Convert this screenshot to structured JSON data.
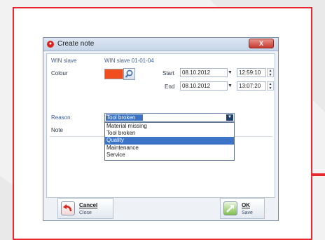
{
  "dialog": {
    "title": "Create note",
    "close_label": "X",
    "win_slave_label": "WIN slave",
    "win_slave_value": "WIN slave 01-01-04",
    "colour_label": "Colour",
    "colour_value": "#f04e1e",
    "start_label": "Start",
    "start_date": "08.10.2012",
    "start_time": "12:59:10",
    "end_label": "End",
    "end_date": "08.10.2012",
    "end_time": "13:07:20",
    "reason_label": "Reason:",
    "reason_value": "Tool broken",
    "note_label": "Note",
    "reason_options": [
      "Material missing",
      "Tool broken",
      "Quality",
      "Maintenance",
      "Service"
    ],
    "reason_highlighted": "Quality",
    "cancel_label": "Cancel",
    "cancel_sub": "Close",
    "ok_label": "OK",
    "ok_sub": "Save"
  },
  "colors": {
    "accent_red": "#e8272e",
    "selection_blue": "#3b73c6"
  }
}
